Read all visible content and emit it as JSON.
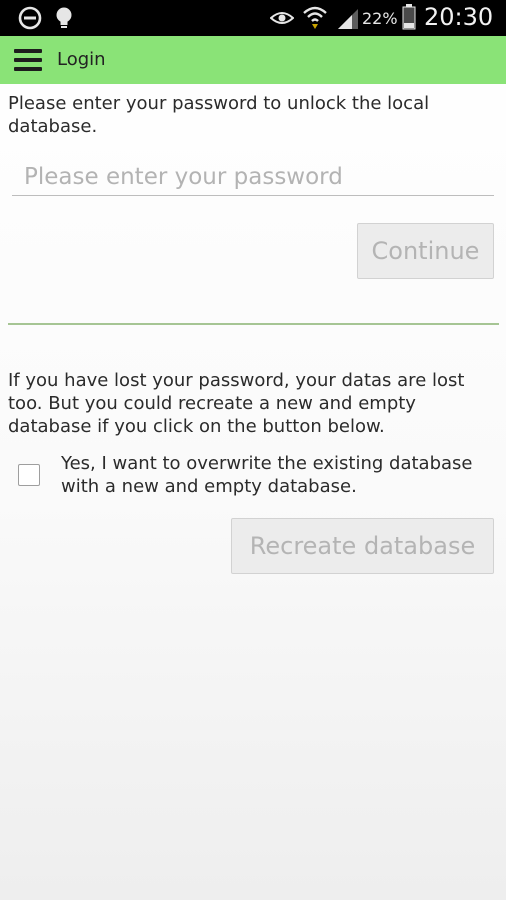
{
  "status_bar": {
    "icons": [
      "do-not-disturb-icon",
      "lightbulb-icon",
      "eye-icon",
      "wifi-icon",
      "signal-icon",
      "battery-icon"
    ],
    "battery": "22%",
    "time": "20:30"
  },
  "app_bar": {
    "title": "Login",
    "background": "#8ae377"
  },
  "login": {
    "intro": "Please enter your password to unlock the local database.",
    "password_placeholder": "Please enter your password",
    "continue_label": "Continue"
  },
  "recovery": {
    "warning": "If you have lost your password, your datas are lost too. But you could recreate a new and empty database if you click on the button below.",
    "checkbox_label": "Yes, I want to overwrite the existing database with a new and empty database.",
    "checkbox_checked": false,
    "recreate_label": "Recreate database"
  }
}
